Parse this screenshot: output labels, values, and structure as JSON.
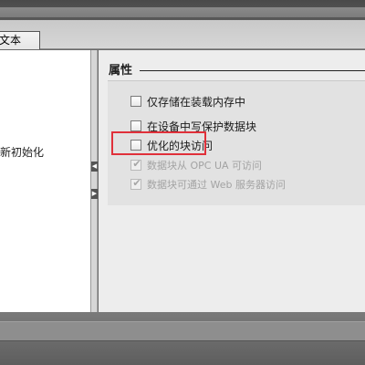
{
  "tabs": [
    {
      "label": "文本"
    }
  ],
  "left_panel": {
    "items": [
      {
        "label": "新初始化"
      }
    ]
  },
  "properties": {
    "title": "属性",
    "options": [
      {
        "label": "仅存储在装载内存中",
        "checked": false,
        "enabled": true
      },
      {
        "label": "在设备中写保护数据块",
        "checked": false,
        "enabled": true
      },
      {
        "label": "优化的块访问",
        "checked": false,
        "enabled": true,
        "highlighted": true
      },
      {
        "label": "数据块从 OPC UA 可访问",
        "checked": true,
        "enabled": false
      },
      {
        "label": "数据块可通过 Web 服务器访问",
        "checked": true,
        "enabled": false
      }
    ]
  },
  "colors": {
    "highlight_border": "#e0303a",
    "panel_background": "#ededed"
  }
}
